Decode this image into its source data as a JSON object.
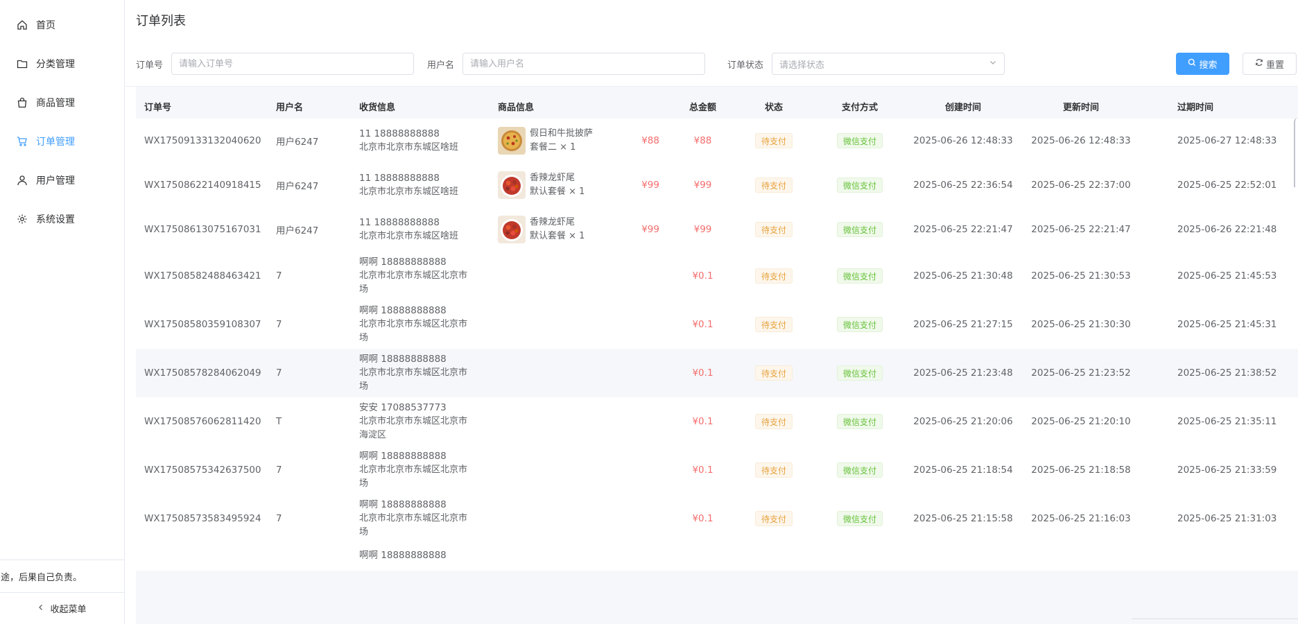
{
  "sidebar": {
    "items": [
      {
        "label": "首页",
        "icon": "home-icon",
        "active": false
      },
      {
        "label": "分类管理",
        "icon": "folder-icon",
        "active": false
      },
      {
        "label": "商品管理",
        "icon": "shopping-bag-icon",
        "active": false
      },
      {
        "label": "订单管理",
        "icon": "shopping-cart-icon",
        "active": true
      },
      {
        "label": "用户管理",
        "icon": "user-icon",
        "active": false
      },
      {
        "label": "系统设置",
        "icon": "gear-icon",
        "active": false
      }
    ],
    "disclaimer": "非法用途，后果自己负责。",
    "collapse_label": "收起菜单"
  },
  "page": {
    "title": "订单列表"
  },
  "filters": {
    "order_no_label": "订单号",
    "order_no_placeholder": "请输入订单号",
    "username_label": "用户名",
    "username_placeholder": "请输入用户名",
    "status_label": "订单状态",
    "status_placeholder": "请选择状态",
    "search_label": "搜索",
    "reset_label": "重置"
  },
  "colors": {
    "primary": "#409eff",
    "price": "#f56c6c",
    "warning": "#e6a23c",
    "success": "#67c23a"
  },
  "table": {
    "headers": [
      "订单号",
      "用户名",
      "收货信息",
      "商品信息",
      "总金额",
      "状态",
      "支付方式",
      "创建时间",
      "更新时间",
      "过期时间"
    ],
    "rows": [
      {
        "order_no": "WX17509133132040620",
        "user": "用户6247",
        "recv_name": "11 18888888888",
        "recv_addr1": "北京市北京市东城区啥班",
        "recv_addr2": "",
        "goods_name": "假日和牛批披萨",
        "goods_spec": "套餐二 × 1",
        "goods_price": "¥88",
        "goods_img": "pizza",
        "total": "¥88",
        "status": "待支付",
        "pay": "微信支付",
        "created": "2025-06-26 12:48:33",
        "updated": "2025-06-26 12:48:33",
        "expire": "2025-06-27 12:48:33"
      },
      {
        "order_no": "WX17508622140918415",
        "user": "用户6247",
        "recv_name": "11 18888888888",
        "recv_addr1": "北京市北京市东城区啥班",
        "recv_addr2": "",
        "goods_name": "香辣龙虾尾",
        "goods_spec": "默认套餐 × 1",
        "goods_price": "¥99",
        "goods_img": "crayfish",
        "total": "¥99",
        "status": "待支付",
        "pay": "微信支付",
        "created": "2025-06-25 22:36:54",
        "updated": "2025-06-25 22:37:00",
        "expire": "2025-06-25 22:52:01"
      },
      {
        "order_no": "WX17508613075167031",
        "user": "用户6247",
        "recv_name": "11 18888888888",
        "recv_addr1": "北京市北京市东城区啥班",
        "recv_addr2": "",
        "goods_name": "香辣龙虾尾",
        "goods_spec": "默认套餐 × 1",
        "goods_price": "¥99",
        "goods_img": "crayfish",
        "total": "¥99",
        "status": "待支付",
        "pay": "微信支付",
        "created": "2025-06-25 22:21:47",
        "updated": "2025-06-25 22:21:47",
        "expire": "2025-06-26 22:21:48"
      },
      {
        "order_no": "WX17508582488463421",
        "user": "7",
        "recv_name": "啊啊 18888888888",
        "recv_addr1": "北京市北京市东城区北京市",
        "recv_addr2": "场",
        "goods_name": "",
        "goods_spec": "",
        "goods_price": "",
        "goods_img": "",
        "total": "¥0.1",
        "status": "待支付",
        "pay": "微信支付",
        "created": "2025-06-25 21:30:48",
        "updated": "2025-06-25 21:30:53",
        "expire": "2025-06-25 21:45:53"
      },
      {
        "order_no": "WX17508580359108307",
        "user": "7",
        "recv_name": "啊啊 18888888888",
        "recv_addr1": "北京市北京市东城区北京市",
        "recv_addr2": "场",
        "goods_name": "",
        "goods_spec": "",
        "goods_price": "",
        "goods_img": "",
        "total": "¥0.1",
        "status": "待支付",
        "pay": "微信支付",
        "created": "2025-06-25 21:27:15",
        "updated": "2025-06-25 21:30:30",
        "expire": "2025-06-25 21:45:31"
      },
      {
        "order_no": "WX17508578284062049",
        "user": "7",
        "recv_name": "啊啊 18888888888",
        "recv_addr1": "北京市北京市东城区北京市",
        "recv_addr2": "场",
        "goods_name": "",
        "goods_spec": "",
        "goods_price": "",
        "goods_img": "",
        "total": "¥0.1",
        "status": "待支付",
        "pay": "微信支付",
        "created": "2025-06-25 21:23:48",
        "updated": "2025-06-25 21:23:52",
        "expire": "2025-06-25 21:38:52",
        "hover": true
      },
      {
        "order_no": "WX17508576062811420",
        "user": "T",
        "recv_name": "安安 17088537773",
        "recv_addr1": "北京市北京市东城区北京市",
        "recv_addr2": "海淀区",
        "goods_name": "",
        "goods_spec": "",
        "goods_price": "",
        "goods_img": "",
        "total": "¥0.1",
        "status": "待支付",
        "pay": "微信支付",
        "created": "2025-06-25 21:20:06",
        "updated": "2025-06-25 21:20:10",
        "expire": "2025-06-25 21:35:11"
      },
      {
        "order_no": "WX17508575342637500",
        "user": "7",
        "recv_name": "啊啊 18888888888",
        "recv_addr1": "北京市北京市东城区北京市",
        "recv_addr2": "场",
        "goods_name": "",
        "goods_spec": "",
        "goods_price": "",
        "goods_img": "",
        "total": "¥0.1",
        "status": "待支付",
        "pay": "微信支付",
        "created": "2025-06-25 21:18:54",
        "updated": "2025-06-25 21:18:58",
        "expire": "2025-06-25 21:33:59"
      },
      {
        "order_no": "WX17508573583495924",
        "user": "7",
        "recv_name": "啊啊 18888888888",
        "recv_addr1": "北京市北京市东城区北京市",
        "recv_addr2": "场",
        "goods_name": "",
        "goods_spec": "",
        "goods_price": "",
        "goods_img": "",
        "total": "¥0.1",
        "status": "待支付",
        "pay": "微信支付",
        "created": "2025-06-25 21:15:58",
        "updated": "2025-06-25 21:16:03",
        "expire": "2025-06-25 21:31:03"
      },
      {
        "order_no": "",
        "user": "",
        "recv_name": "啊啊 18888888888",
        "recv_addr1": "",
        "recv_addr2": "",
        "goods_name": "",
        "goods_spec": "",
        "goods_price": "",
        "goods_img": "",
        "total": "",
        "status": "",
        "pay": "",
        "created": "",
        "updated": "",
        "expire": "",
        "partial": true
      }
    ]
  }
}
